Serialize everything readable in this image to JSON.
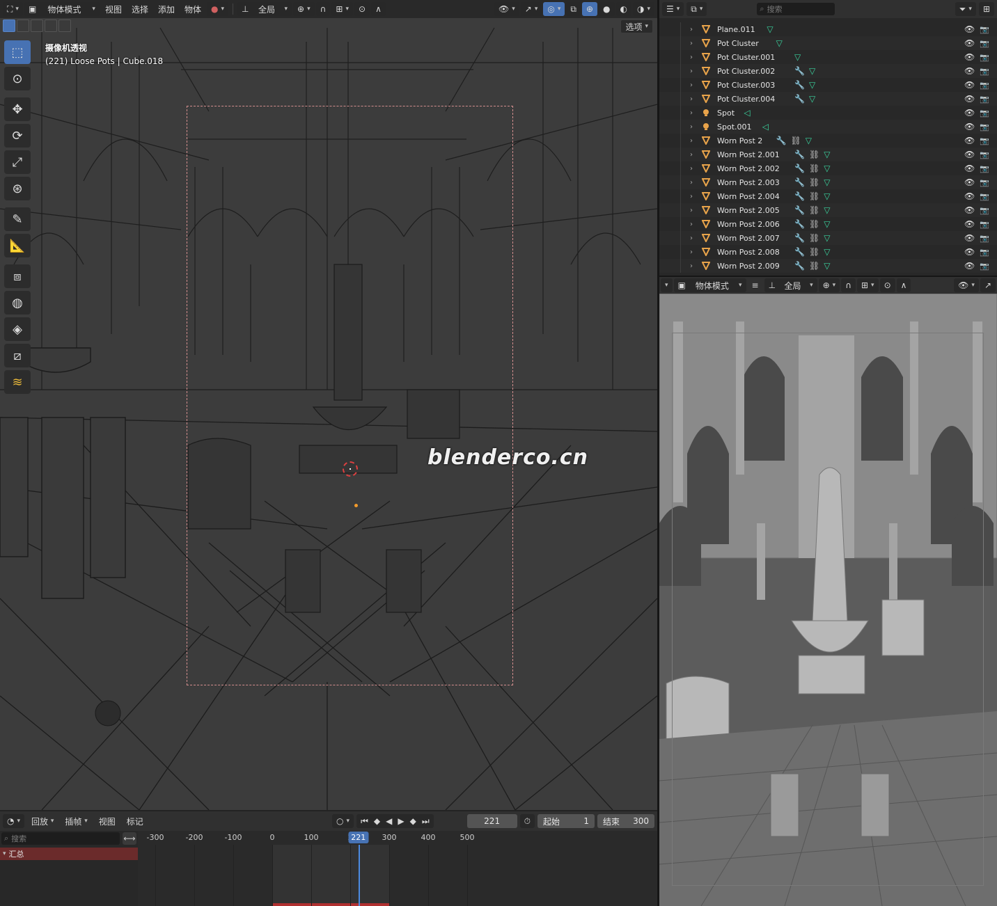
{
  "viewport": {
    "header": {
      "mode_label": "物体模式",
      "menus": [
        "视图",
        "选择",
        "添加",
        "物体"
      ],
      "transform_orientation": "全局",
      "options_label": "选项"
    },
    "overlay": {
      "camera_title": "摄像机透视",
      "context": "(221) Loose Pots | Cube.018"
    },
    "watermark": "blenderco.cn",
    "tools": [
      "select-box",
      "cursor",
      "move",
      "rotate",
      "scale",
      "transform",
      "annotate",
      "measure",
      "add-cube",
      "sculpt-ball",
      "snap",
      "frame",
      "grease-pencil"
    ]
  },
  "timeline": {
    "menus": [
      "回放",
      "插帧",
      "视图",
      "标记"
    ],
    "current_frame": "221",
    "start_label": "起始",
    "start_value": "1",
    "end_label": "结束",
    "end_value": "300",
    "search_placeholder": "搜索",
    "summary_label": "汇总",
    "ruler_ticks": [
      "-300",
      "-200",
      "-100",
      "0",
      "100",
      "2",
      "300",
      "400",
      "500"
    ],
    "playhead_label": "221"
  },
  "outliner": {
    "search_placeholder": "搜索",
    "rows": [
      {
        "name": "Plane.011",
        "type": "mesh",
        "mods": [
          "mesh-data"
        ]
      },
      {
        "name": "Pot Cluster",
        "type": "mesh",
        "mods": [
          "mesh-data"
        ]
      },
      {
        "name": "Pot Cluster.001",
        "type": "mesh",
        "mods": [
          "mesh-data"
        ]
      },
      {
        "name": "Pot Cluster.002",
        "type": "mesh",
        "mods": [
          "wrench",
          "mesh-data"
        ]
      },
      {
        "name": "Pot Cluster.003",
        "type": "mesh",
        "mods": [
          "wrench",
          "mesh-data"
        ]
      },
      {
        "name": "Pot Cluster.004",
        "type": "mesh",
        "mods": [
          "wrench",
          "mesh-data"
        ]
      },
      {
        "name": "Spot",
        "type": "light",
        "mods": [
          "light-data"
        ]
      },
      {
        "name": "Spot.001",
        "type": "light",
        "mods": [
          "light-data"
        ]
      },
      {
        "name": "Worn Post 2",
        "type": "mesh",
        "mods": [
          "wrench",
          "constraint",
          "mesh-data"
        ]
      },
      {
        "name": "Worn Post 2.001",
        "type": "mesh",
        "mods": [
          "wrench",
          "constraint",
          "mesh-data"
        ]
      },
      {
        "name": "Worn Post 2.002",
        "type": "mesh",
        "mods": [
          "wrench",
          "constraint",
          "mesh-data"
        ]
      },
      {
        "name": "Worn Post 2.003",
        "type": "mesh",
        "mods": [
          "wrench",
          "constraint",
          "mesh-data"
        ]
      },
      {
        "name": "Worn Post 2.004",
        "type": "mesh",
        "mods": [
          "wrench",
          "constraint",
          "mesh-data"
        ]
      },
      {
        "name": "Worn Post 2.005",
        "type": "mesh",
        "mods": [
          "wrench",
          "constraint",
          "mesh-data"
        ]
      },
      {
        "name": "Worn Post 2.006",
        "type": "mesh",
        "mods": [
          "wrench",
          "constraint",
          "mesh-data"
        ]
      },
      {
        "name": "Worn Post 2.007",
        "type": "mesh",
        "mods": [
          "wrench",
          "constraint",
          "mesh-data"
        ]
      },
      {
        "name": "Worn Post 2.008",
        "type": "mesh",
        "mods": [
          "wrench",
          "constraint",
          "mesh-data"
        ]
      },
      {
        "name": "Worn Post 2.009",
        "type": "mesh",
        "mods": [
          "wrench",
          "constraint",
          "mesh-data"
        ]
      }
    ]
  },
  "viewport2": {
    "mode_label": "物体模式",
    "transform_orientation": "全局"
  },
  "colors": {
    "accent": "#4772b3",
    "object_orange": "#e8a34a",
    "data_green": "#3ad6a0",
    "modifier_blue": "#6fa0e6",
    "summary_red": "#6b2b2b",
    "camera_frame": "#d48e8e",
    "cursor_red": "#e04040"
  }
}
